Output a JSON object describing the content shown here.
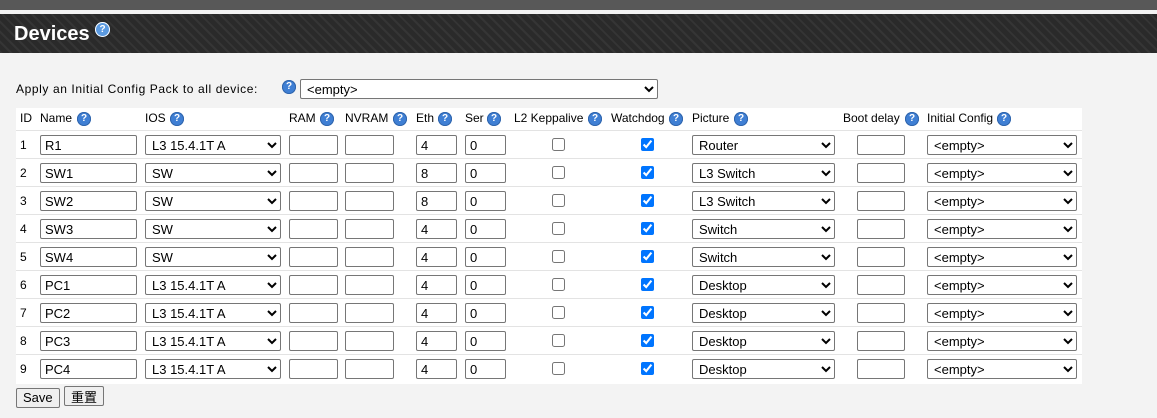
{
  "page": {
    "title": "Devices",
    "apply_label": "Apply an Initial Config Pack to all device:",
    "apply_value": "<empty>"
  },
  "columns": {
    "id": "ID",
    "name": "Name",
    "ios": "IOS",
    "ram": "RAM",
    "nvram": "NVRAM",
    "eth": "Eth",
    "ser": "Ser",
    "l2": "L2 Keppalive",
    "watchdog": "Watchdog",
    "picture": "Picture",
    "boot": "Boot delay",
    "initcfg": "Initial Config"
  },
  "rows": [
    {
      "id": "1",
      "name": "R1",
      "ios": "L3 15.4.1T A",
      "ram": "",
      "nvram": "",
      "eth": "4",
      "ser": "0",
      "l2": false,
      "watchdog": true,
      "picture": "Router",
      "boot": "",
      "initcfg": "<empty>"
    },
    {
      "id": "2",
      "name": "SW1",
      "ios": "SW",
      "ram": "",
      "nvram": "",
      "eth": "8",
      "ser": "0",
      "l2": false,
      "watchdog": true,
      "picture": "L3 Switch",
      "boot": "",
      "initcfg": "<empty>"
    },
    {
      "id": "3",
      "name": "SW2",
      "ios": "SW",
      "ram": "",
      "nvram": "",
      "eth": "8",
      "ser": "0",
      "l2": false,
      "watchdog": true,
      "picture": "L3 Switch",
      "boot": "",
      "initcfg": "<empty>"
    },
    {
      "id": "4",
      "name": "SW3",
      "ios": "SW",
      "ram": "",
      "nvram": "",
      "eth": "4",
      "ser": "0",
      "l2": false,
      "watchdog": true,
      "picture": "Switch",
      "boot": "",
      "initcfg": "<empty>"
    },
    {
      "id": "5",
      "name": "SW4",
      "ios": "SW",
      "ram": "",
      "nvram": "",
      "eth": "4",
      "ser": "0",
      "l2": false,
      "watchdog": true,
      "picture": "Switch",
      "boot": "",
      "initcfg": "<empty>"
    },
    {
      "id": "6",
      "name": "PC1",
      "ios": "L3 15.4.1T A",
      "ram": "",
      "nvram": "",
      "eth": "4",
      "ser": "0",
      "l2": false,
      "watchdog": true,
      "picture": "Desktop",
      "boot": "",
      "initcfg": "<empty>"
    },
    {
      "id": "7",
      "name": "PC2",
      "ios": "L3 15.4.1T A",
      "ram": "",
      "nvram": "",
      "eth": "4",
      "ser": "0",
      "l2": false,
      "watchdog": true,
      "picture": "Desktop",
      "boot": "",
      "initcfg": "<empty>"
    },
    {
      "id": "8",
      "name": "PC3",
      "ios": "L3 15.4.1T A",
      "ram": "",
      "nvram": "",
      "eth": "4",
      "ser": "0",
      "l2": false,
      "watchdog": true,
      "picture": "Desktop",
      "boot": "",
      "initcfg": "<empty>"
    },
    {
      "id": "9",
      "name": "PC4",
      "ios": "L3 15.4.1T A",
      "ram": "",
      "nvram": "",
      "eth": "4",
      "ser": "0",
      "l2": false,
      "watchdog": true,
      "picture": "Desktop",
      "boot": "",
      "initcfg": "<empty>"
    }
  ],
  "actions": {
    "save": "Save",
    "reset": "重置"
  },
  "icons": {
    "help": "help-icon",
    "help_glyph": "?"
  },
  "colors": {
    "header_bg": "#2a2a2a",
    "help_blue": "#3f7fd4",
    "checkbox_blue": "#0075ff"
  }
}
